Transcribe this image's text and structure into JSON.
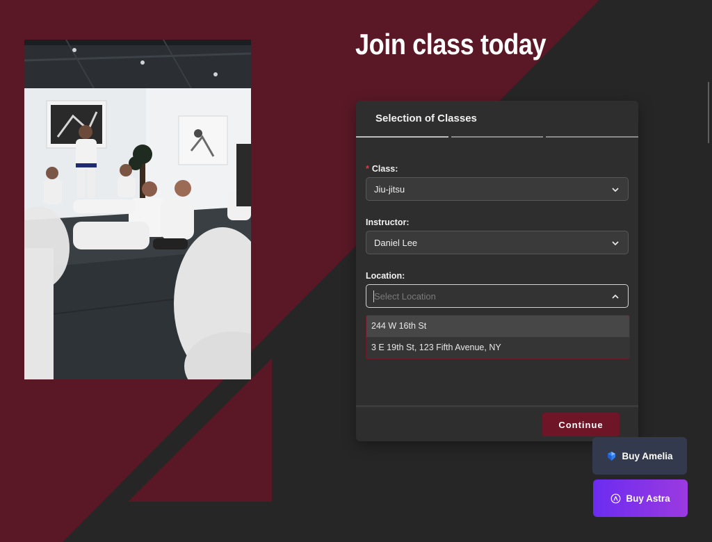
{
  "headline": "Join class today",
  "form": {
    "title": "Selection of Classes",
    "steps": [
      {
        "active": true
      },
      {
        "active": false
      },
      {
        "active": false
      }
    ],
    "class_field": {
      "required_mark": "*",
      "label": "Class:",
      "value": "Jiu-jitsu"
    },
    "instructor_field": {
      "label": "Instructor:",
      "value": "Daniel Lee"
    },
    "location_field": {
      "label": "Location:",
      "placeholder": "Select Location",
      "options": [
        "244 W 16th St",
        "3 E 19th St, 123 Fifth Avenue, NY"
      ]
    },
    "continue_label": "Continue"
  },
  "promo": {
    "buy_amelia_label": "Buy Amelia",
    "buy_astra_label": "Buy Astra"
  },
  "colors": {
    "maroon": "#5a1826",
    "background": "#262626",
    "card": "#2e2e2e",
    "continue_button": "#6e1527",
    "required_star": "#e0384f"
  },
  "icons": {
    "amelia": "amelia-logo-icon",
    "astra": "astra-logo-icon",
    "dropdown": "chevron-down-icon",
    "dropdown_open": "chevron-up-icon"
  }
}
